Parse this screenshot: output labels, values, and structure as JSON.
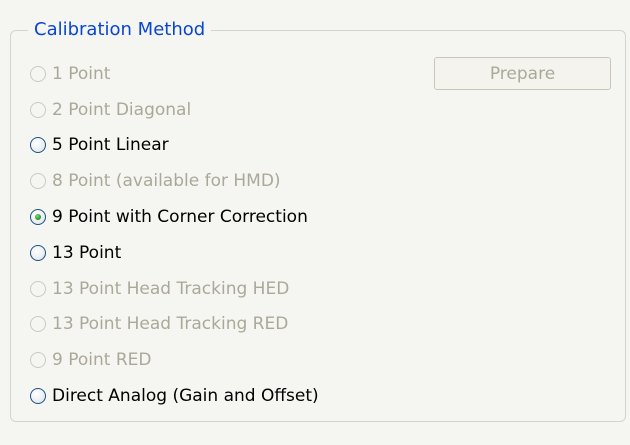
{
  "group": {
    "title": "Calibration Method"
  },
  "prepare_button": {
    "label": "Prepare",
    "enabled": false
  },
  "options": [
    {
      "label": "1 Point",
      "enabled": false,
      "checked": false
    },
    {
      "label": "2 Point Diagonal",
      "enabled": false,
      "checked": false
    },
    {
      "label": "5 Point Linear",
      "enabled": true,
      "checked": false
    },
    {
      "label": "8 Point (available for HMD)",
      "enabled": false,
      "checked": false
    },
    {
      "label": "9 Point with Corner Correction",
      "enabled": true,
      "checked": true
    },
    {
      "label": "13 Point",
      "enabled": true,
      "checked": false
    },
    {
      "label": "13 Point Head Tracking HED",
      "enabled": false,
      "checked": false
    },
    {
      "label": "13 Point Head Tracking RED",
      "enabled": false,
      "checked": false
    },
    {
      "label": "9 Point RED",
      "enabled": false,
      "checked": false
    },
    {
      "label": "Direct Analog (Gain and Offset)",
      "enabled": true,
      "checked": false
    }
  ],
  "colors": {
    "group_title": "#0a45d0",
    "disabled_text": "#aca899",
    "selected_dot": "#2c9a2b"
  }
}
